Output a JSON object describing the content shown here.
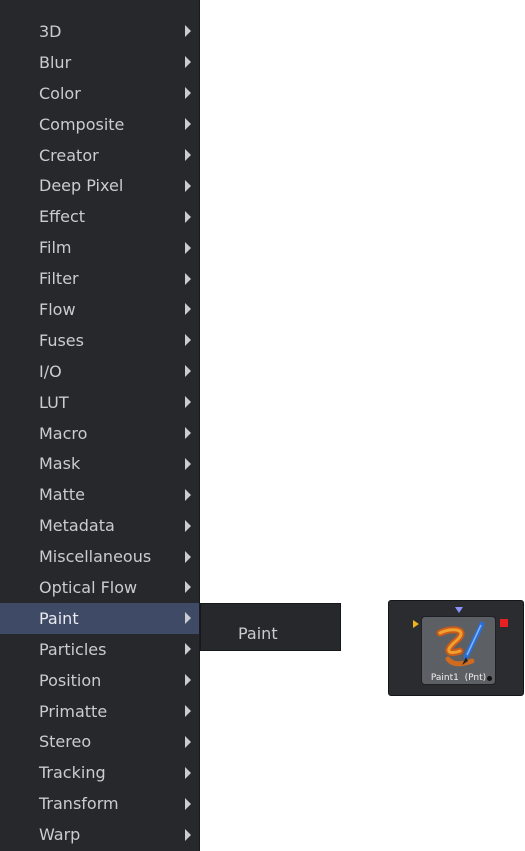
{
  "menu": {
    "items": [
      {
        "label": "3D",
        "has_submenu": true
      },
      {
        "label": "Blur",
        "has_submenu": true
      },
      {
        "label": "Color",
        "has_submenu": true
      },
      {
        "label": "Composite",
        "has_submenu": true
      },
      {
        "label": "Creator",
        "has_submenu": true
      },
      {
        "label": "Deep Pixel",
        "has_submenu": true
      },
      {
        "label": "Effect",
        "has_submenu": true
      },
      {
        "label": "Film",
        "has_submenu": true
      },
      {
        "label": "Filter",
        "has_submenu": true
      },
      {
        "label": "Flow",
        "has_submenu": true
      },
      {
        "label": "Fuses",
        "has_submenu": true
      },
      {
        "label": "I/O",
        "has_submenu": true
      },
      {
        "label": "LUT",
        "has_submenu": true
      },
      {
        "label": "Macro",
        "has_submenu": true
      },
      {
        "label": "Mask",
        "has_submenu": true
      },
      {
        "label": "Matte",
        "has_submenu": true
      },
      {
        "label": "Metadata",
        "has_submenu": true
      },
      {
        "label": "Miscellaneous",
        "has_submenu": true
      },
      {
        "label": "Optical Flow",
        "has_submenu": true
      },
      {
        "label": "Paint",
        "has_submenu": true,
        "active": true
      },
      {
        "label": "Particles",
        "has_submenu": true
      },
      {
        "label": "Position",
        "has_submenu": true
      },
      {
        "label": "Primatte",
        "has_submenu": true
      },
      {
        "label": "Stereo",
        "has_submenu": true
      },
      {
        "label": "Tracking",
        "has_submenu": true
      },
      {
        "label": "Transform",
        "has_submenu": true
      },
      {
        "label": "Warp",
        "has_submenu": true
      }
    ]
  },
  "submenu": {
    "items": [
      {
        "label": "Paint"
      }
    ]
  },
  "node": {
    "label": "Paint1  (Pnt)",
    "icon": "paint-brush-icon"
  },
  "colors": {
    "menu_bg": "#26282c",
    "menu_text": "#c9ccd0",
    "active_bg": "#3e4a66",
    "input_arrow": "#f2b21a",
    "effect_mask_arrow": "#8c92ff",
    "output_port": "#e81f23"
  }
}
